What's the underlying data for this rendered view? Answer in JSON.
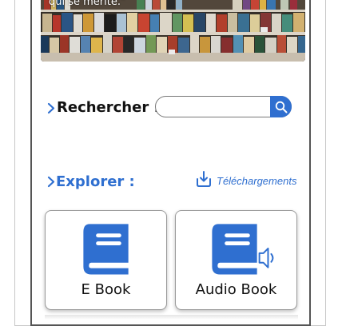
{
  "hero": {
    "quote_fragment": "qui se mérite.\"",
    "image_icon": "bookshelf-photo"
  },
  "search": {
    "label": "Rechercher :",
    "value": "",
    "placeholder": "",
    "button_icon": "search-icon"
  },
  "explore": {
    "label": "Explorer :",
    "downloads_label": "Téléchargements",
    "downloads_icon": "download-tray-icon"
  },
  "cards": [
    {
      "label": "E Book",
      "icon": "book-icon"
    },
    {
      "label": "Audio Book",
      "icon": "book-speaker-icon"
    }
  ],
  "colors": {
    "accent": "#2f6fd0",
    "text": "#111111",
    "border": "#555555"
  }
}
